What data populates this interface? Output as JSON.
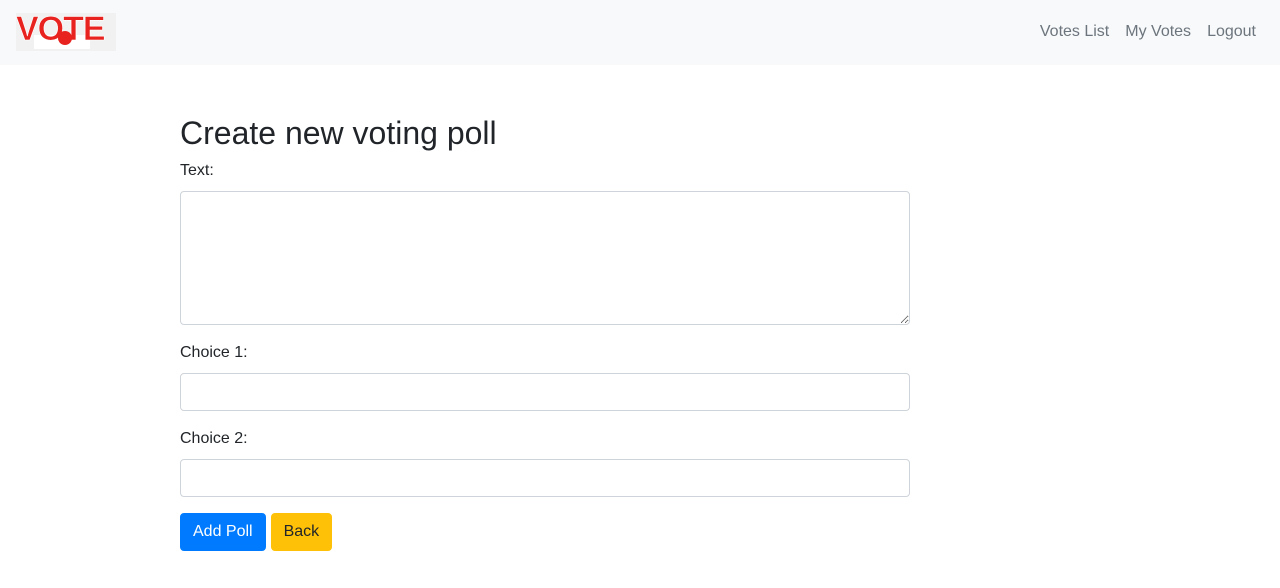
{
  "navbar": {
    "logo_text": "VOTE",
    "links": [
      {
        "label": "Votes List"
      },
      {
        "label": "My Votes"
      },
      {
        "label": "Logout"
      }
    ]
  },
  "form": {
    "title": "Create new voting poll",
    "text_label": "Text:",
    "text_value": "",
    "choice1_label": "Choice 1:",
    "choice1_value": "",
    "choice2_label": "Choice 2:",
    "choice2_value": "",
    "submit_label": "Add Poll",
    "back_label": "Back"
  },
  "colors": {
    "navbar_bg": "#f8f9fa",
    "logo_red": "#e8231f",
    "primary": "#007bff",
    "warning": "#ffc107"
  }
}
